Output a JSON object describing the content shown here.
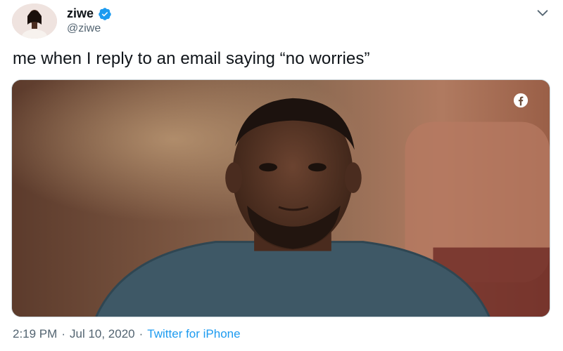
{
  "tweet": {
    "author": {
      "display_name": "ziwe",
      "handle": "@ziwe",
      "verified": true,
      "avatar_icon": "user-avatar"
    },
    "text": "me when I reply to an email saying “no worries”",
    "media": {
      "overlay_icon": "facebook-icon"
    },
    "meta": {
      "time": "2:19 PM",
      "separator": "·",
      "date": "Jul 10, 2020",
      "source": "Twitter for iPhone"
    },
    "menu_icon": "chevron-down-icon"
  },
  "colors": {
    "text_primary": "#0f1419",
    "text_secondary": "#536471",
    "accent": "#1d9bf0"
  }
}
